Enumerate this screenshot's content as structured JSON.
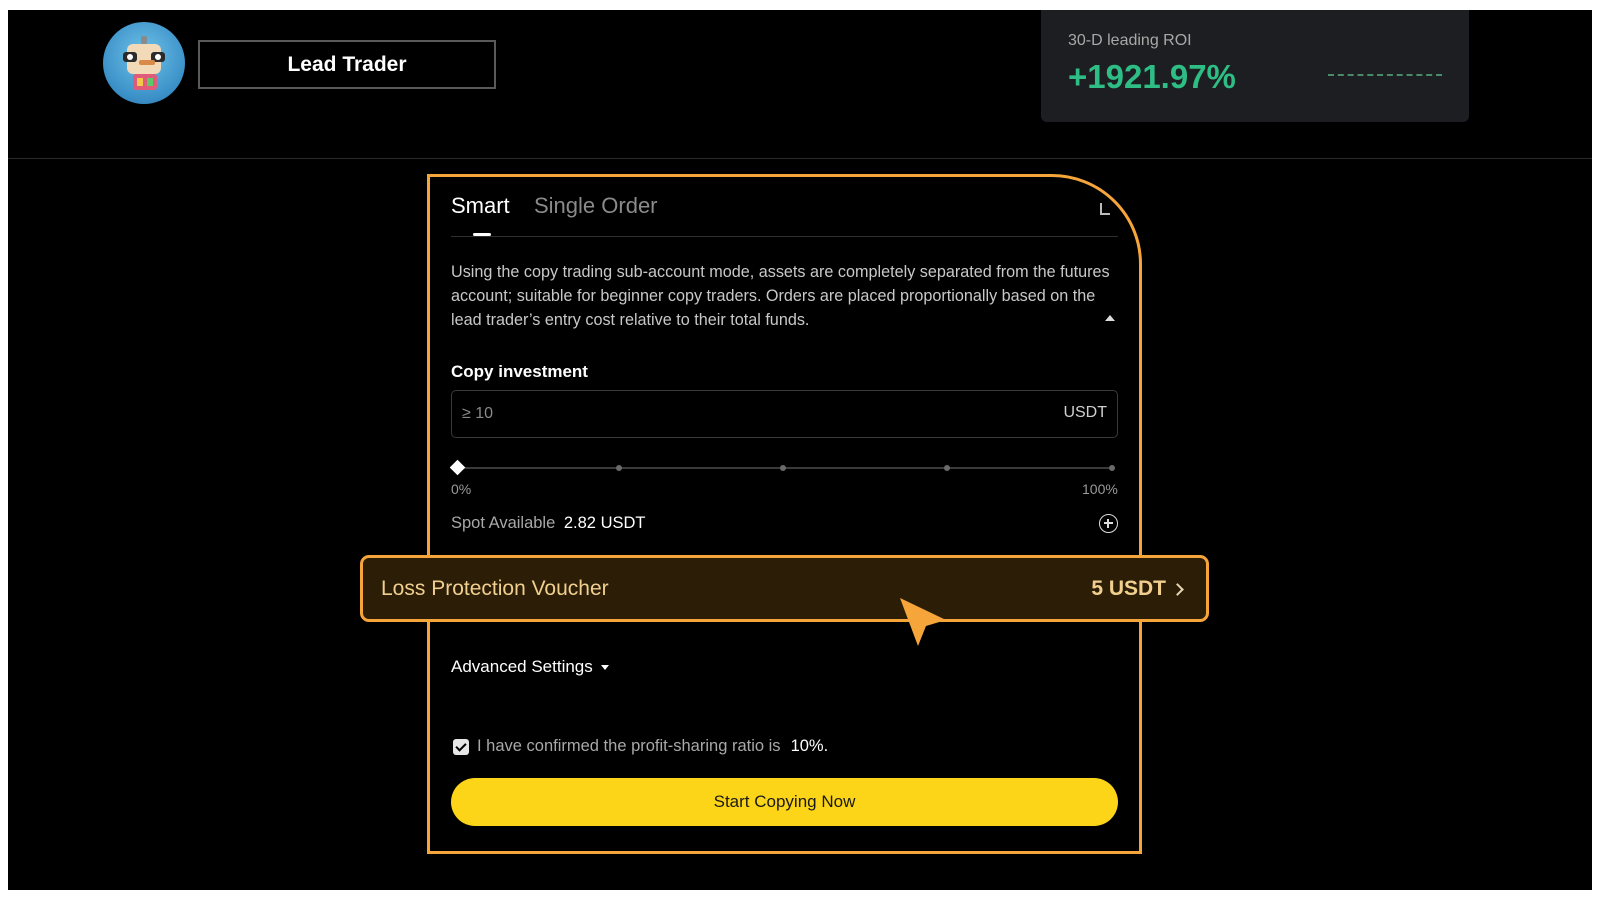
{
  "header": {
    "trader_title": "Lead Trader",
    "roi_label": "30-D leading ROI",
    "roi_value": "+1921.97%"
  },
  "tabs": [
    {
      "label": "Smart",
      "active": true
    },
    {
      "label": "Single Order",
      "active": false
    }
  ],
  "description": "Using the copy trading sub-account mode, assets are completely separated from the futures account; suitable for beginner copy traders. Orders are placed proportionally based on the lead trader’s entry cost relative to their total funds.",
  "copy_investment": {
    "label": "Copy investment",
    "placeholder": "≥ 10",
    "unit": "USDT",
    "slider_min_label": "0%",
    "slider_max_label": "100%",
    "slider_value_percent": 0
  },
  "spot": {
    "label": "Spot Available",
    "value": "2.82 USDT"
  },
  "voucher": {
    "label": "Loss Protection Voucher",
    "value": "5 USDT"
  },
  "advanced_settings_label": "Advanced Settings",
  "confirm": {
    "text": "I have confirmed the profit-sharing ratio is",
    "ratio": "10%.",
    "checked": true
  },
  "start_button_label": "Start Copying Now",
  "colors": {
    "accent_orange": "#f5a53a",
    "roi_green": "#2ebd85",
    "button_yellow": "#fcd518",
    "voucher_bg": "#2c1d06",
    "voucher_text": "#f1cf8e"
  },
  "icons": {
    "avatar": "robot-avatar",
    "spot_add": "plus-circle-icon",
    "voucher_chevron": "chevron-right-icon",
    "advanced_caret": "caret-down-icon",
    "description_toggle": "caret-up-icon",
    "cursor": "pointer-arrow-icon"
  }
}
